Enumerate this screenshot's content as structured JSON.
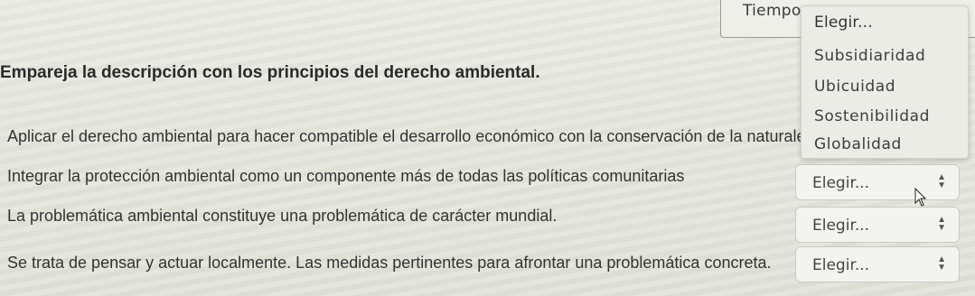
{
  "header": {
    "timer_label": "Tiempo re"
  },
  "question": {
    "title": "Empareja la descripción con los principios del derecho ambiental."
  },
  "rows": [
    {
      "text": "Aplicar el derecho ambiental para hacer compatible el desarrollo económico con la conservación de la naturaleza.",
      "selected": ""
    },
    {
      "text": "Integrar la protección ambiental como un componente más de todas las políticas comunitarias",
      "selected": "Elegir..."
    },
    {
      "text": "La problemática ambiental constituye una problemática de carácter mundial.",
      "selected": "Elegir..."
    },
    {
      "text": "Se trata de pensar y actuar localmente. Las medidas pertinentes para afrontar una problemática concreta.",
      "selected": "Elegir..."
    }
  ],
  "dropdown": {
    "options": [
      "Elegir...",
      "Subsidiaridad",
      "Ubicuidad",
      "Sostenibilidad",
      "Globalidad"
    ]
  },
  "icons": {
    "select_arrow": "up-down-arrows-icon",
    "cursor": "mouse-pointer-icon"
  }
}
